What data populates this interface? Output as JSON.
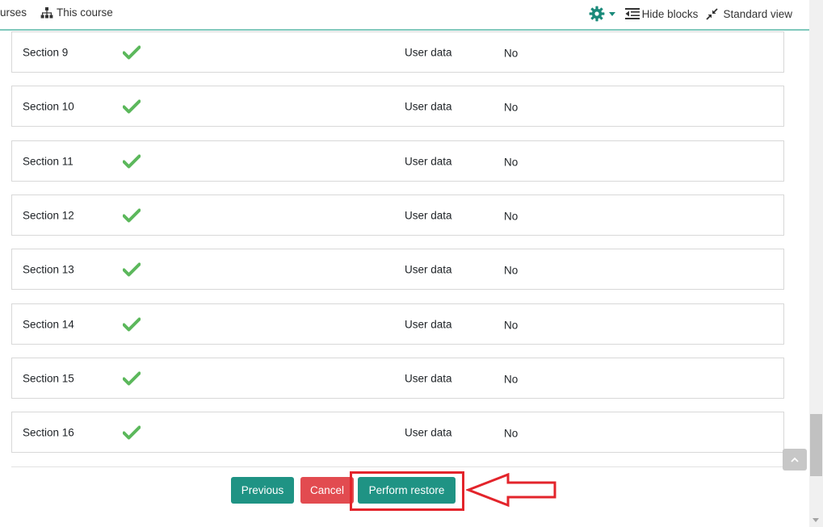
{
  "navbar": {
    "courses_label": "urses",
    "this_course_label": "This course",
    "hide_blocks_label": "Hide blocks",
    "standard_view_label": "Standard view",
    "icons": [
      "sitemap-icon",
      "gear-icon",
      "hide-blocks-icon",
      "compress-icon"
    ]
  },
  "rows": [
    {
      "name": "Section 9",
      "user_data_label": "User data",
      "user_data_value": "No"
    },
    {
      "name": "Section 10",
      "user_data_label": "User data",
      "user_data_value": "No"
    },
    {
      "name": "Section 11",
      "user_data_label": "User data",
      "user_data_value": "No"
    },
    {
      "name": "Section 12",
      "user_data_label": "User data",
      "user_data_value": "No"
    },
    {
      "name": "Section 13",
      "user_data_label": "User data",
      "user_data_value": "No"
    },
    {
      "name": "Section 14",
      "user_data_label": "User data",
      "user_data_value": "No"
    },
    {
      "name": "Section 15",
      "user_data_label": "User data",
      "user_data_value": "No"
    },
    {
      "name": "Section 16",
      "user_data_label": "User data",
      "user_data_value": "No"
    }
  ],
  "buttons": {
    "previous": "Previous",
    "cancel": "Cancel",
    "perform_restore": "Perform restore"
  },
  "colors": {
    "primary": "#1f9384",
    "danger": "#e24b50",
    "check": "#5cb85c",
    "highlight": "#e3242b"
  }
}
